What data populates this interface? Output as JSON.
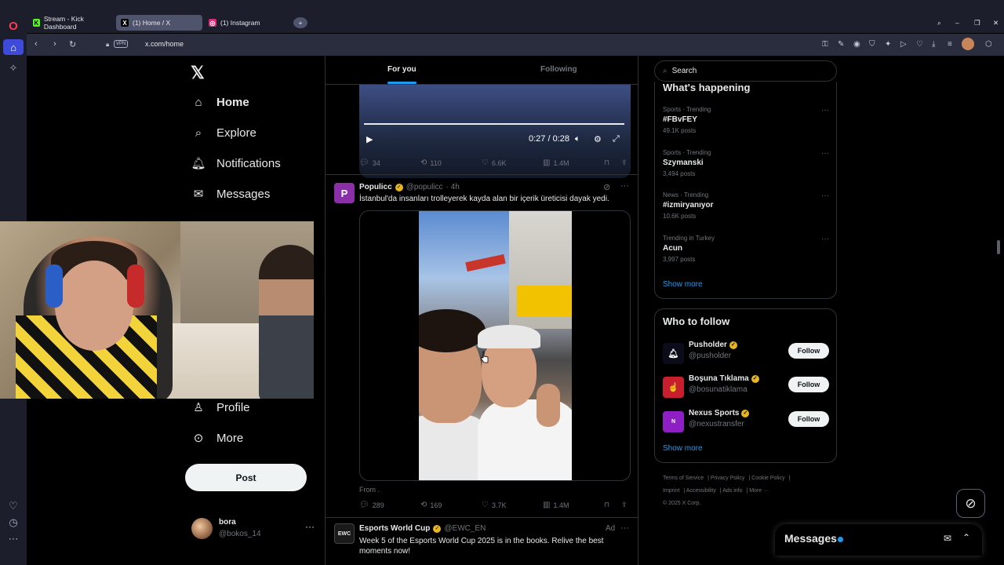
{
  "browser": {
    "tabs": [
      {
        "label": "Stream - Kick Dashboard",
        "favicon": "K"
      },
      {
        "label": "(1) Home / X",
        "favicon": "X"
      },
      {
        "label": "(1) Instagram",
        "favicon": "◎"
      }
    ],
    "new_tab_icon": "+",
    "vpn_badge": "VPN",
    "url": "x.com/home"
  },
  "x": {
    "logo": "𝕏",
    "nav": {
      "home": "Home",
      "explore": "Explore",
      "notifications": "Notifications",
      "messages": "Messages",
      "profile": "Profile",
      "more": "More"
    },
    "post_button": "Post",
    "account": {
      "name": "bora",
      "handle": "@bokos_14"
    }
  },
  "feed": {
    "tabs": {
      "for_you": "For you",
      "following": "Following"
    },
    "video_top": {
      "time": "0:27 / 0:28",
      "replies": "34",
      "reposts": "110",
      "likes": "6.6K",
      "views": "1.4M"
    },
    "tweet1": {
      "avatar_letter": "P",
      "name": "Populicc",
      "handle": "@populicc",
      "time": "· 4h",
      "text": "İstanbul'da insanları trolleyerek kayda alan bir içerik üreticisi dayak yedi.",
      "from": "From .",
      "replies": "289",
      "reposts": "169",
      "likes": "3.7K",
      "views": "1.4M"
    },
    "tweet2": {
      "avatar_label": "EWC",
      "name": "Esports World Cup",
      "handle": "@EWC_EN",
      "ad": "Ad",
      "text": "Week 5 of the Esports World Cup 2025 is in the books. Relive the best moments now!"
    }
  },
  "sidebar": {
    "search_placeholder": "Search",
    "happening_title": "What's happening",
    "trends": [
      {
        "context": "Sports · Trending",
        "title": "#FBvFEY",
        "count": "49.1K posts"
      },
      {
        "context": "Sports · Trending",
        "title": "Szymanski",
        "count": "3,494 posts"
      },
      {
        "context": "News · Trending",
        "title": "#izmiryanıyor",
        "count": "10.6K posts"
      },
      {
        "context": "Trending in Turkey",
        "title": "Acun",
        "count": "3,997 posts"
      }
    ],
    "show_more": "Show more",
    "wtf_title": "Who to follow",
    "follow_suggestions": [
      {
        "name": "Pusholder",
        "handle": "@pusholder",
        "button": "Follow"
      },
      {
        "name": "Boşuna Tıklama",
        "handle": "@bosunatiklama",
        "button": "Follow"
      },
      {
        "name": "Nexus Sports",
        "handle": "@nexustransfer",
        "button": "Follow"
      }
    ],
    "wtf_show_more": "Show more",
    "footer": {
      "terms": "Terms of Service",
      "privacy": "Privacy Policy",
      "cookie": "Cookie Policy",
      "imprint": "Imprint",
      "accessibility": "Accessibility",
      "ads": "Ads info",
      "more": "More ···",
      "copyright": "© 2025 X Corp."
    }
  },
  "messages_drawer": {
    "title": "Messages"
  },
  "colors": {
    "accent": "#1d9bf0",
    "verified_gold": "#e7b523",
    "background": "#000000",
    "browser_chrome": "#1c1e2b"
  }
}
